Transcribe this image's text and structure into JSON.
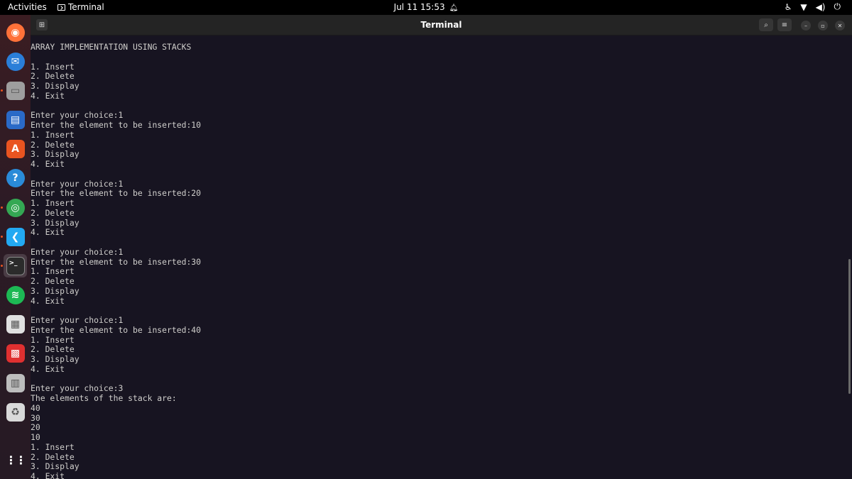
{
  "topbar": {
    "activities": "Activities",
    "app_name": "Terminal",
    "clock": "Jul 11  15:53"
  },
  "dock": {
    "items": [
      {
        "name": "firefox-icon",
        "color": "#ff7139"
      },
      {
        "name": "thunderbird-icon",
        "color": "#2a7ed8"
      },
      {
        "name": "files-icon",
        "color": "#9e9e9e"
      },
      {
        "name": "libreoffice-writer-icon",
        "color": "#2a6ac7"
      },
      {
        "name": "app-center-icon",
        "color": "#e95420"
      },
      {
        "name": "help-icon",
        "color": "#2a8bd8"
      },
      {
        "name": "chrome-icon",
        "color": "#34a853"
      },
      {
        "name": "vscode-icon",
        "color": "#23a9f2"
      },
      {
        "name": "terminal-icon",
        "color": "#2b2b2b"
      },
      {
        "name": "spotify-icon",
        "color": "#1db954"
      },
      {
        "name": "document-viewer-icon",
        "color": "#e0e0e0"
      },
      {
        "name": "colorful-app-icon",
        "color": "#e03030"
      },
      {
        "name": "disk-icon",
        "color": "#bdbdbd"
      },
      {
        "name": "trash-icon",
        "color": "#d9d9d9"
      },
      {
        "name": "show-apps-icon",
        "color": "#ffffff"
      }
    ]
  },
  "window": {
    "title": "Terminal"
  },
  "terminal": {
    "lines": [
      "ARRAY IMPLEMENTATION USING STACKS",
      "",
      "1. Insert",
      "2. Delete",
      "3. Display",
      "4. Exit",
      "",
      "Enter your choice:1",
      "Enter the element to be inserted:10",
      "1. Insert",
      "2. Delete",
      "3. Display",
      "4. Exit",
      "",
      "Enter your choice:1",
      "Enter the element to be inserted:20",
      "1. Insert",
      "2. Delete",
      "3. Display",
      "4. Exit",
      "",
      "Enter your choice:1",
      "Enter the element to be inserted:30",
      "1. Insert",
      "2. Delete",
      "3. Display",
      "4. Exit",
      "",
      "Enter your choice:1",
      "Enter the element to be inserted:40",
      "1. Insert",
      "2. Delete",
      "3. Display",
      "4. Exit",
      "",
      "Enter your choice:3",
      "The elements of the stack are:",
      "40",
      "30",
      "20",
      "10",
      "1. Insert",
      "2. Delete",
      "3. Display",
      "4. Exit"
    ]
  }
}
